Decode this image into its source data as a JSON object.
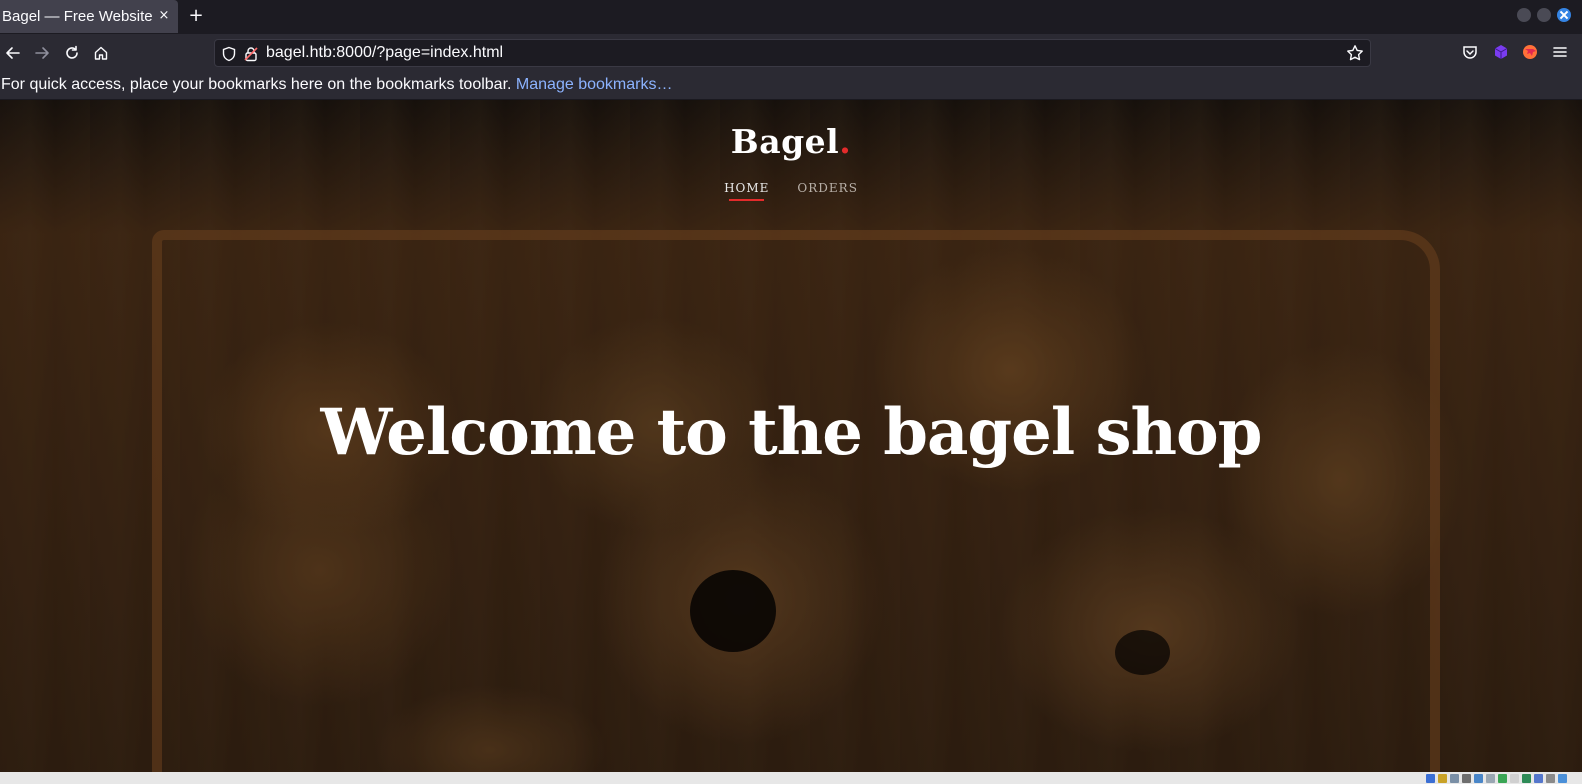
{
  "browser": {
    "tab_title": "Bagel — Free Website",
    "tab_close": "×",
    "new_tab": "+",
    "url": "bagel.htb:8000/?page=index.html",
    "bookmarks_hint": "For quick access, place your bookmarks here on the bookmarks toolbar.",
    "manage_bookmarks": "Manage bookmarks…"
  },
  "site": {
    "brand": "Bagel",
    "brand_dot": ".",
    "nav": [
      {
        "label": "HOME",
        "active": true
      },
      {
        "label": "ORDERS",
        "active": false
      }
    ],
    "hero_title": "Welcome to the bagel shop"
  },
  "colors": {
    "accent": "#e32b2b",
    "link": "#8cb3ff",
    "toolbar": "#2b2a33",
    "tab_active": "#42414d"
  }
}
